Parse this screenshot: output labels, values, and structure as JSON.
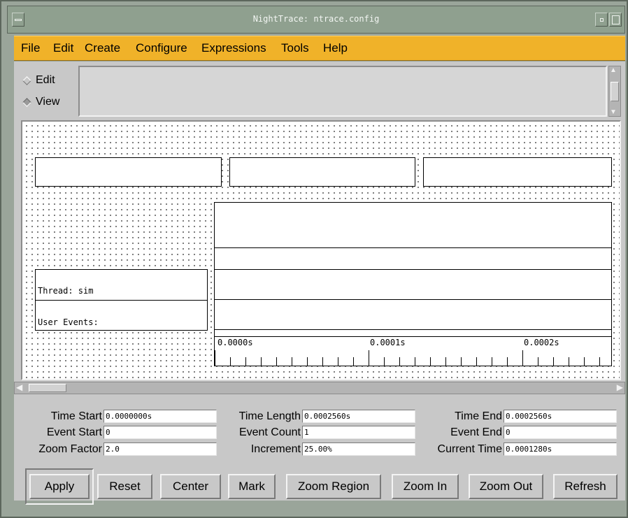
{
  "window": {
    "title": "NightTrace: ntrace.config"
  },
  "menu": [
    "File",
    "Edit",
    "Create",
    "Configure",
    "Expressions",
    "Tools",
    "Help"
  ],
  "mode": {
    "edit_label": "Edit",
    "view_label": "View",
    "selected": "View"
  },
  "timeline": {
    "rows": [
      {
        "label": "Thread: sim"
      },
      {
        "label": "User Events:"
      }
    ],
    "ruler": [
      "0.0000s",
      "0.0001s",
      "0.0002s"
    ]
  },
  "params": {
    "time_start": {
      "label": "Time Start",
      "value": "0.0000000s"
    },
    "event_start": {
      "label": "Event Start",
      "value": "0"
    },
    "zoom_factor": {
      "label": "Zoom Factor",
      "value": "2.0"
    },
    "time_length": {
      "label": "Time Length",
      "value": "0.0002560s"
    },
    "event_count": {
      "label": "Event Count",
      "value": "1"
    },
    "increment": {
      "label": "Increment",
      "value": "25.00%"
    },
    "time_end": {
      "label": "Time End",
      "value": "0.0002560s"
    },
    "event_end": {
      "label": "Event End",
      "value": "0"
    },
    "current_time": {
      "label": "Current Time",
      "value": "0.0001280s"
    }
  },
  "buttons": {
    "apply": "Apply",
    "reset": "Reset",
    "center": "Center",
    "mark": "Mark",
    "zoom_region": "Zoom Region",
    "zoom_in": "Zoom In",
    "zoom_out": "Zoom Out",
    "refresh": "Refresh"
  },
  "colors": {
    "menubar": "#f0b229",
    "titlebar": "#8fa08f",
    "panel": "#c8c8c8"
  }
}
